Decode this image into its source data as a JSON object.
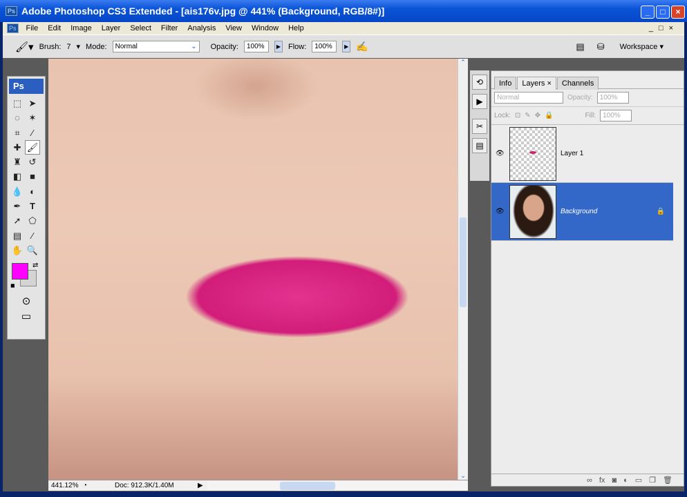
{
  "window": {
    "title": "Adobe Photoshop CS3 Extended - [ais176v.jpg @ 441% (Background, RGB/8#)]",
    "logo": "Ps"
  },
  "menu": [
    "File",
    "Edit",
    "Image",
    "Layer",
    "Select",
    "Filter",
    "Analysis",
    "View",
    "Window",
    "Help"
  ],
  "options": {
    "brush_label": "Brush:",
    "brush_size": "7",
    "mode_label": "Mode:",
    "mode_value": "Normal",
    "opacity_label": "Opacity:",
    "opacity_value": "100%",
    "flow_label": "Flow:",
    "flow_value": "100%",
    "workspace_label": "Workspace"
  },
  "toolbox": {
    "header": "Ps"
  },
  "colors": {
    "foreground": "#ff00ff",
    "background": "#d4d4d4",
    "selection": "#3468c8"
  },
  "status": {
    "zoom": "441.12%",
    "doc": "Doc: 912.3K/1.40M"
  },
  "layers_panel": {
    "tabs": [
      "Info",
      "Layers",
      "Channels"
    ],
    "blend_mode": "Normal",
    "opacity_label": "Opacity:",
    "opacity_value": "100%",
    "lock_label": "Lock:",
    "fill_label": "Fill:",
    "fill_value": "100%",
    "layers": [
      {
        "name": "Layer 1",
        "visible": true,
        "selected": false
      },
      {
        "name": "Background",
        "visible": true,
        "selected": true,
        "locked": true
      }
    ]
  }
}
